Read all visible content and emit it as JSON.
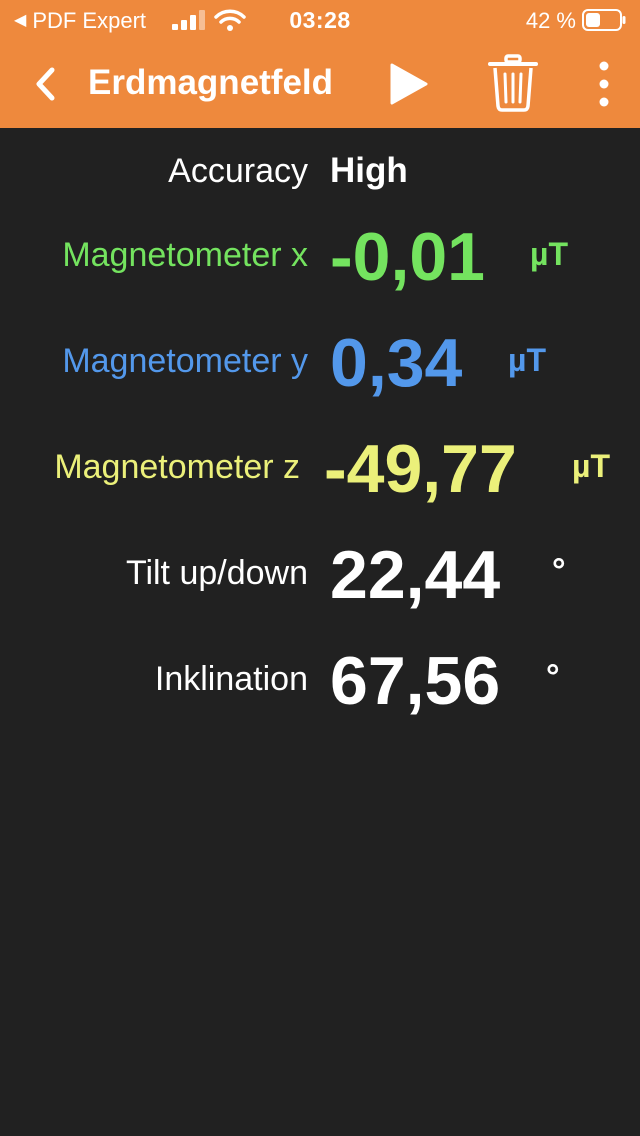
{
  "status_bar": {
    "back_app": "PDF Expert",
    "time": "03:28",
    "battery": "42 %"
  },
  "nav": {
    "title": "Erdmagnetfeld"
  },
  "colors": {
    "accent": "#EE893D",
    "background": "#212121",
    "x": "#74E35F",
    "y": "#5398EB",
    "z": "#EBF07A",
    "neutral": "#FFFFFF"
  },
  "readings": {
    "accuracy": {
      "label": "Accuracy",
      "value": "High"
    },
    "mag_x": {
      "label": "Magnetometer x",
      "value": "-0,01",
      "unit": "µT"
    },
    "mag_y": {
      "label": "Magnetometer y",
      "value": "0,34",
      "unit": "µT"
    },
    "mag_z": {
      "label": "Magnetometer z",
      "value": "-49,77",
      "unit": "µT"
    },
    "tilt": {
      "label": "Tilt up/down",
      "value": "22,44",
      "unit": "°"
    },
    "inclination": {
      "label": "Inklination",
      "value": "67,56",
      "unit": "°"
    }
  }
}
